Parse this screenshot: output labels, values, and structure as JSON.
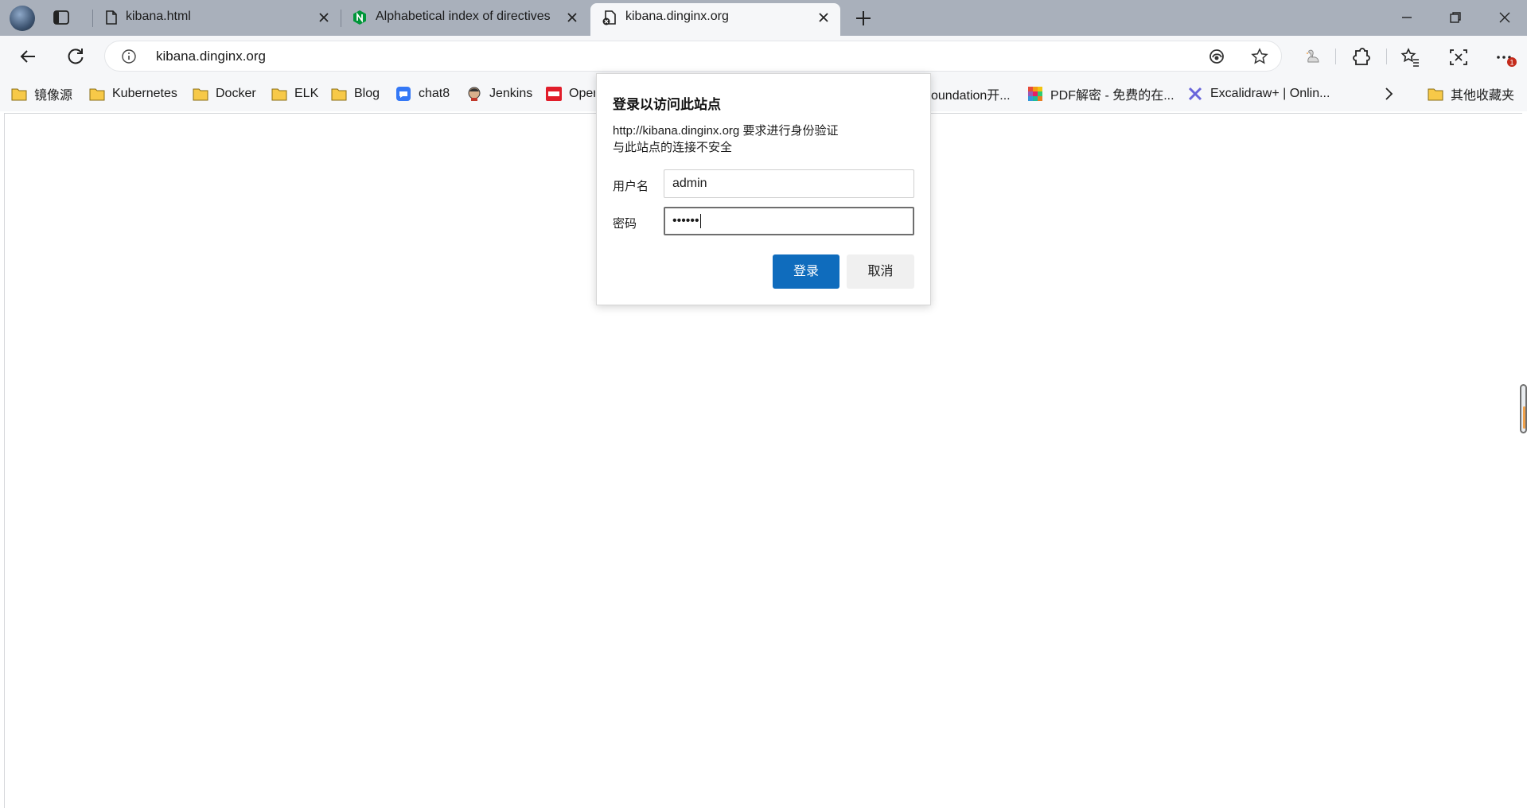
{
  "tabs": [
    {
      "title": "kibana.html",
      "icon": "page-icon"
    },
    {
      "title": "Alphabetical index of directives",
      "icon": "nginx-icon"
    },
    {
      "title": "kibana.dinginx.org",
      "icon": "page-warning-icon",
      "active": true
    }
  ],
  "address_bar": {
    "url": "kibana.dinginx.org",
    "info_icon": "info-icon"
  },
  "bookmarks": [
    {
      "label": "镜像源",
      "icon": "folder-icon"
    },
    {
      "label": "Kubernetes",
      "icon": "folder-icon"
    },
    {
      "label": "Docker",
      "icon": "folder-icon"
    },
    {
      "label": "ELK",
      "icon": "folder-icon"
    },
    {
      "label": "Blog",
      "icon": "folder-icon"
    },
    {
      "label": "chat8",
      "icon": "chat-icon"
    },
    {
      "label": "Jenkins",
      "icon": "jenkins-icon"
    },
    {
      "label": "Oper",
      "icon": "openresty-icon"
    },
    {
      "label": "oundation开...",
      "icon": ""
    },
    {
      "label": "PDF解密 - 免费的在...",
      "icon": "pdf-tool-icon"
    },
    {
      "label": "Excalidraw+ | Onlin...",
      "icon": "excalidraw-icon"
    }
  ],
  "other_bookmarks": "其他收藏夹",
  "notification_badge": "1",
  "auth_dialog": {
    "title": "登录以访问此站点",
    "message_line1": "http://kibana.dinginx.org 要求进行身份验证",
    "message_line2": "与此站点的连接不安全",
    "username_label": "用户名",
    "username_value": "admin",
    "password_label": "密码",
    "password_masked": "••••••",
    "login_button": "登录",
    "cancel_button": "取消"
  },
  "colors": {
    "titlebar": "#a9b0bb",
    "toolbar": "#f6f7f9",
    "primary_button": "#0f6cbd",
    "folder": "#f7c948"
  }
}
